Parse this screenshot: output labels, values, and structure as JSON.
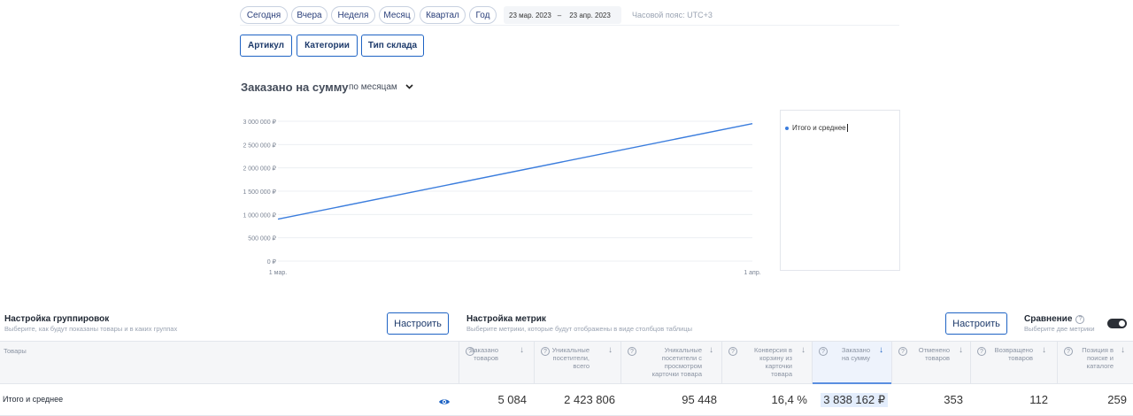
{
  "period_pills": [
    "Сегодня",
    "Вчера",
    "Неделя",
    "Месяц",
    "Квартал",
    "Год"
  ],
  "date_range": {
    "from": "23 мар. 2023",
    "separator": "–",
    "to": "23 апр. 2023"
  },
  "timezone": "Часовой пояс: UTC+3",
  "grouping_buttons": [
    "Артикул",
    "Категории",
    "Тип склада"
  ],
  "chart_header": {
    "title": "Заказано на сумму",
    "period_select": "по месяцам",
    "chevron_icon": "chevron-down-icon"
  },
  "legend": {
    "items": [
      "Итого и среднее"
    ]
  },
  "chart_data": {
    "type": "line",
    "title": "",
    "x": [
      "1 мар.",
      "1 апр."
    ],
    "series": [
      {
        "name": "Итого и среднее",
        "values": [
          900000,
          2950000
        ],
        "color": "#3b7ddd"
      }
    ],
    "ylim": [
      0,
      3000000
    ],
    "y_ticks": [
      0,
      500000,
      1000000,
      1500000,
      2000000,
      2500000,
      3000000
    ],
    "y_tick_labels": [
      "0 ₽",
      "500 000 ₽",
      "1 000 000 ₽",
      "1 500 000 ₽",
      "2 000 000 ₽",
      "2 500 000 ₽",
      "3 000 000 ₽"
    ],
    "grid": true
  },
  "grouping_settings": {
    "title": "Настройка группировок",
    "subtitle": "Выберите, как будут показаны товары и в каких группах",
    "button": "Настроить"
  },
  "metric_settings": {
    "title": "Настройка метрик",
    "subtitle": "Выберите метрики, которые будут отображены в виде столбцов таблицы",
    "button": "Настроить"
  },
  "comparison": {
    "title": "Сравнение",
    "subtitle": "Выберите две метрики",
    "enabled": true
  },
  "table": {
    "first_header": "Товары",
    "columns": [
      {
        "lines": [
          "Заказано",
          "товаров"
        ]
      },
      {
        "lines": [
          "Уникальные",
          "посетители,",
          "всего"
        ]
      },
      {
        "lines": [
          "Уникальные",
          "посетители с",
          "просмотром",
          "карточки товара"
        ]
      },
      {
        "lines": [
          "Конверсия в",
          "корзину из",
          "карточки",
          "товара"
        ]
      },
      {
        "lines": [
          "Заказано",
          "на сумму"
        ]
      },
      {
        "lines": [
          "Отменено",
          "товаров"
        ]
      },
      {
        "lines": [
          "Возвращено",
          "товаров"
        ]
      },
      {
        "lines": [
          "Позиция в",
          "поиске и",
          "каталоге"
        ]
      }
    ],
    "rows": [
      {
        "name": "Итого и среднее",
        "values": [
          "5 084",
          "2 423 806",
          "95 448",
          "16,4 %",
          "3 838 162 ₽",
          "353",
          "112",
          "259"
        ]
      }
    ]
  }
}
